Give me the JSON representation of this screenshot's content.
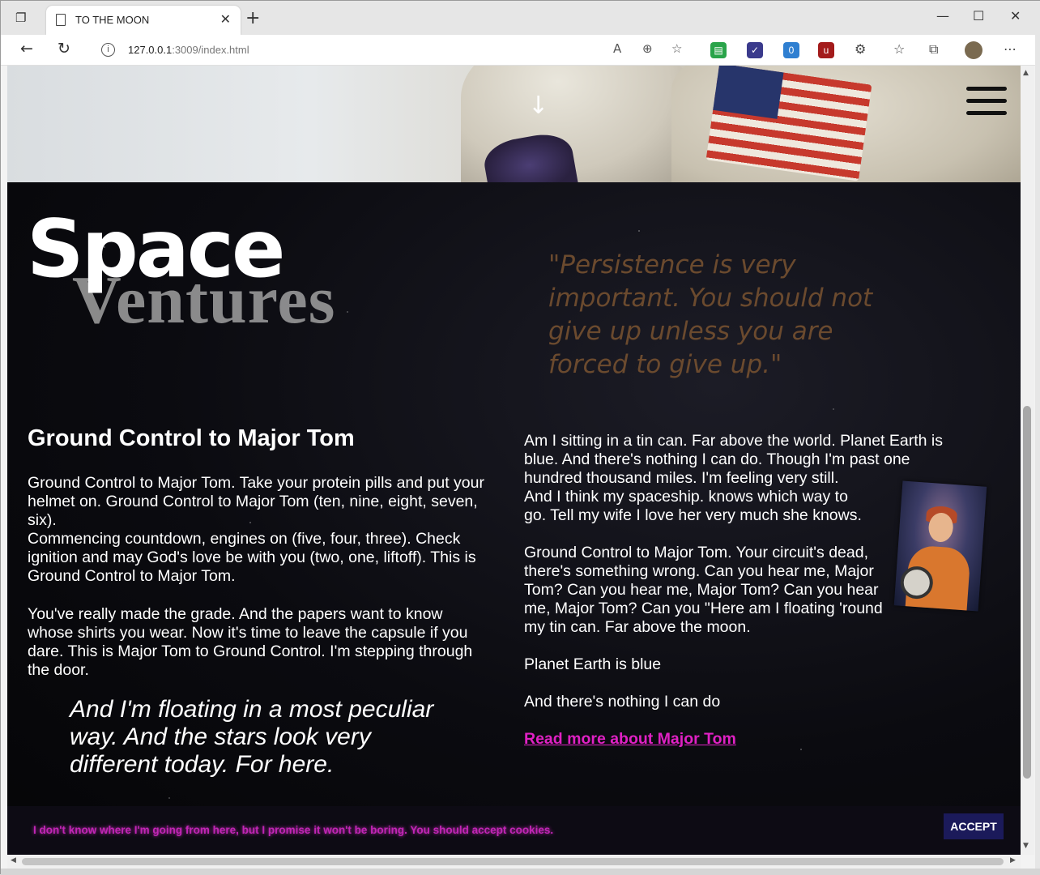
{
  "browser": {
    "tab_title": "TO THE MOON",
    "url_host": "127.0.0.1",
    "url_rest": ":3009/index.html",
    "extension_badge": "0"
  },
  "page": {
    "brand_primary": "Space",
    "brand_secondary": "Ventures",
    "quote": "\"Persistence is very important. You should not give up unless you are forced to give up.\"",
    "heading": "Ground Control to Major Tom",
    "left_p1": "Ground Control to Major Tom. Take your protein pills and put your helmet on. Ground Control to Major Tom (ten, nine, eight, seven, six).",
    "left_p1b": "Commencing countdown, engines on (five, four, three). Check ignition and may God's love be with you (two, one, liftoff). This is Ground Control to Major Tom.",
    "left_p2": "You've really made the grade. And the papers want to know whose shirts you wear. Now it's time to leave the capsule if you dare. This is Major Tom to Ground Control. I'm stepping through the door.",
    "pull_quote": "And I'm floating in a most peculiar way. And the stars look very different today. For here.",
    "right_p1a": "Am I sitting in a tin can. Far above the world. Planet Earth is blue. And there's nothing I can do. Though I'm past one hundred thousand miles. I'm feeling very still.",
    "right_p1b": "And I think my spaceship. knows which way to go. Tell my wife I love her very much she knows.",
    "right_p2": "Ground Control to Major Tom. Your circuit's dead, there's something wrong. Can you hear me, Major Tom? Can you hear me, Major Tom? Can you hear me, Major Tom? Can you \"Here am I floating 'round my tin can. Far above the moon.",
    "right_p3": "Planet Earth is blue",
    "right_p4": "And there's nothing I can do",
    "read_more": "Read more about Major Tom"
  },
  "cookie": {
    "text": "I don't know where I'm going from here, but I promise it won't be boring. You should accept cookies.",
    "accept_label": "ACCEPT"
  },
  "colors": {
    "quote": "#6b4a2e",
    "link": "#e021c4",
    "cookie_text": "#c126b5",
    "accept_bg": "#1b1a5a"
  }
}
